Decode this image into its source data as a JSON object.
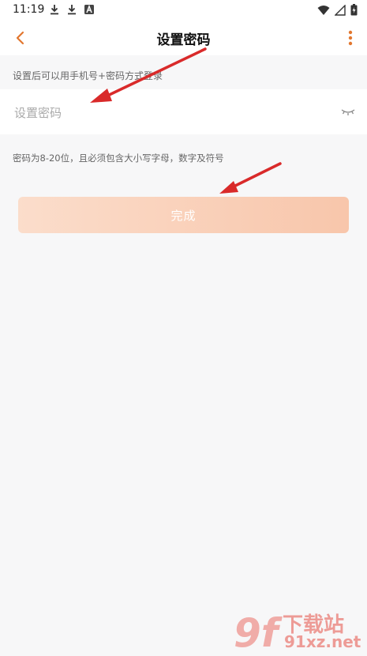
{
  "status_bar": {
    "time": "11:19",
    "icons_left": [
      "download-icon",
      "download-icon",
      "a-icon"
    ],
    "icons_right": [
      "wifi-icon",
      "signal-icon",
      "battery-icon"
    ]
  },
  "nav": {
    "title": "设置密码",
    "back_icon": "chevron-left-icon",
    "more_icon": "more-vertical-icon",
    "accent": "#e2772f"
  },
  "form": {
    "hint_top": "设置后可以用手机号+密码方式登录",
    "password_placeholder": "设置密码",
    "password_value": "",
    "eye_icon": "eye-closed-icon",
    "hint_rule": "密码为8-20位，且必须包含大小写字母，数字及符号"
  },
  "actions": {
    "done_label": "完成",
    "done_gradient": [
      "#fbddcb",
      "#f8c6ab"
    ]
  },
  "annotations": {
    "arrow_color": "#d92a2a"
  },
  "watermark": {
    "logo": "9f",
    "title": "下载站",
    "url": "91xz.net"
  }
}
